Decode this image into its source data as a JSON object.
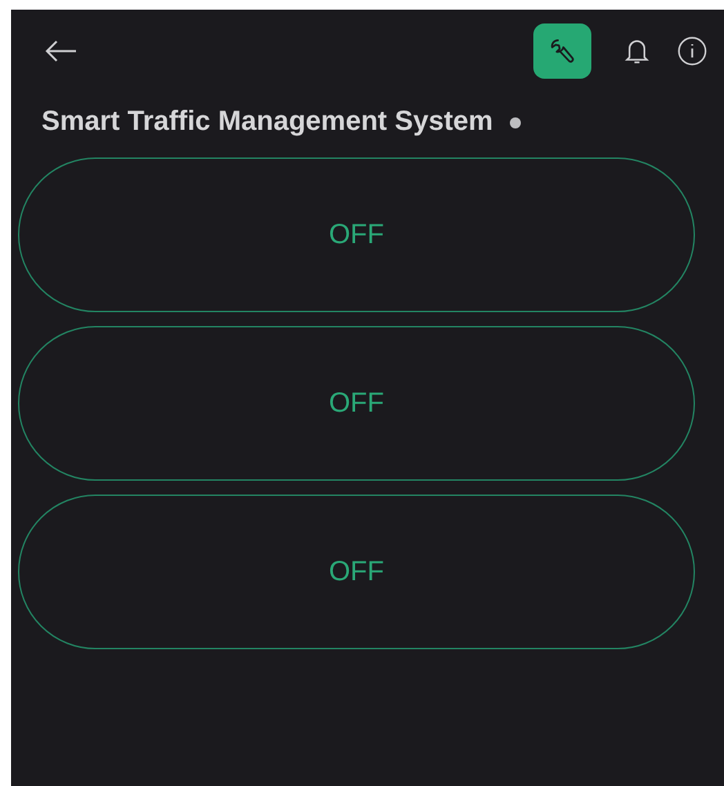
{
  "header": {
    "edit_mode": true
  },
  "device": {
    "name": "Smart Traffic Management System",
    "online": false
  },
  "switches": [
    {
      "label": "OFF",
      "on": false
    },
    {
      "label": "OFF",
      "on": false
    },
    {
      "label": "OFF",
      "on": false
    }
  ]
}
